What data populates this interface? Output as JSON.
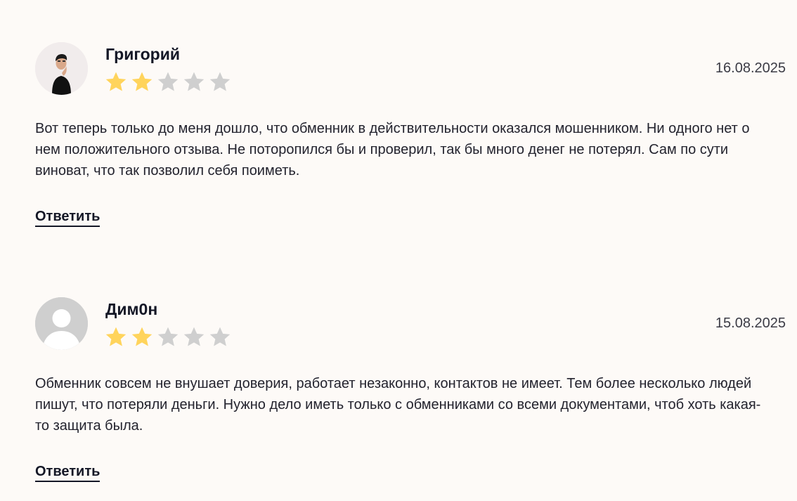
{
  "reviews": [
    {
      "author": "Григорий",
      "avatar": "person-photo",
      "rating": 2,
      "max_rating": 5,
      "date": "16.08.2025",
      "text": "Вот теперь только до меня дошло, что обменник в действительности оказался мошенником. Ни одного нет о нем положительного отзыва. Не поторопился бы и проверил, так бы много денег не потерял. Сам по сути виноват, что так позволил себя поиметь.",
      "reply_label": "Ответить"
    },
    {
      "author": "Дим0н",
      "avatar": "default-user-icon",
      "rating": 2,
      "max_rating": 5,
      "date": "15.08.2025",
      "text": "Обменник совсем не внушает доверия, работает незаконно, контактов не имеет. Тем более несколько людей пишут, что потеряли деньги. Нужно дело иметь только с обменниками со всеми документами, чтоб хоть какая-то защита была.",
      "reply_label": "Ответить"
    }
  ],
  "colors": {
    "star_filled": "#ffd45c",
    "star_empty": "#cfcfcf",
    "background": "#fdfaf7"
  }
}
